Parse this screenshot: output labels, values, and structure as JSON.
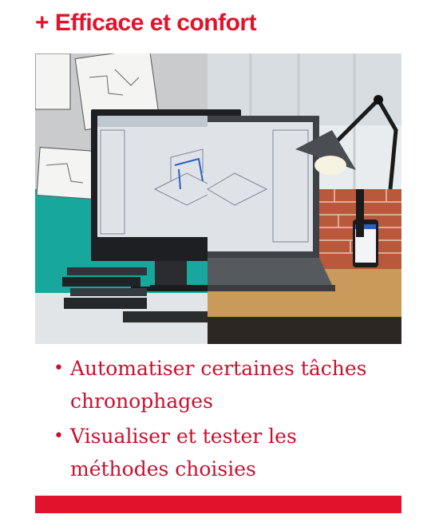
{
  "section": {
    "title": "+ Efficace et confort"
  },
  "photo": {
    "icon": "office-desktop-laptop-image"
  },
  "bullets": [
    {
      "text": "Automatiser certaines tâches chronophages"
    },
    {
      "text": "Visualiser et tester les méthodes choisies"
    }
  ],
  "colors": {
    "accent": "#e3122b",
    "text": "#c8102e"
  }
}
